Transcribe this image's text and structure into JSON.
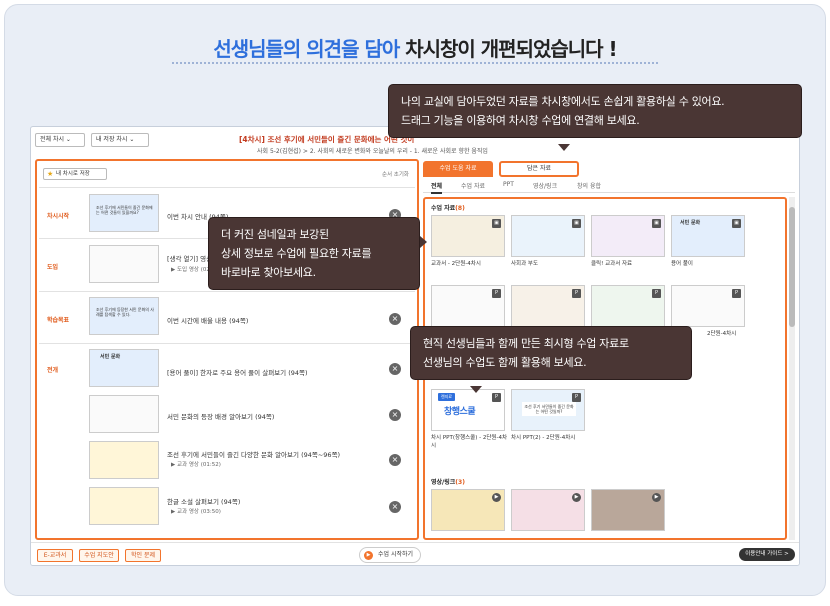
{
  "headline": {
    "part_blue": "선생님들의 의견을 담아",
    "part_dark": " 차시창이 개편되었습니다 !"
  },
  "toolbar": {
    "select_lesson": "전체 차시 ⌄",
    "select_saved": "내 저장 차시 ⌄",
    "lesson_title": "[4차시] 조선 후기에 서민들이 즐긴 문화에는 어떤 것이",
    "lesson_sub": "사회 5-2(김현섭)  >  2. 사회의 새로운 변화와 오늘날의 우리 - 1. 새로운 사회로 향한 움직임"
  },
  "left": {
    "my_lesson_btn": "내 차시로 저장",
    "reset": "순서 초기화",
    "sections": [
      {
        "label": "차시시작"
      },
      {
        "label": "도입"
      },
      {
        "label": "학습목표"
      },
      {
        "label": "전개"
      }
    ],
    "rows": [
      {
        "title": "이번 차시 안내 (94쪽)",
        "sub": ""
      },
      {
        "title": "[생각 열기] 영상 보고 생각 나누기",
        "sub": "▶ 도입 영상 (02:14)"
      },
      {
        "title": "이번 시간에 배울 내용 (94쪽)",
        "sub": ""
      },
      {
        "title": "[용어 풀이] 한자로 주요 용어 풀이 살펴보기 (94쪽)",
        "sub": ""
      },
      {
        "title": "서민 문화의 등장 배경 알아보기 (94쪽)",
        "sub": ""
      },
      {
        "title": "조선 후기에 서민들이 즐긴 다양한 문화 알아보기 (94쪽~96쪽)",
        "sub": "▶ 교과 영상 (01:52)"
      },
      {
        "title": "한글 소설 살펴보기 (94쪽)",
        "sub": "▶ 교과 영상 (03:50)"
      }
    ],
    "thumb_labels": {
      "t1": "조선 후기에 서민들이 즐긴 문화에는 어떤 것들이 있을까요?",
      "t3": "조선 후기에 등장한 서민 문화의 사례를 탐색할 수 있다.",
      "t4": "서민 문화"
    }
  },
  "bottom": {
    "btn1": "E-교과서",
    "btn2": "수업 지도안",
    "btn3": "학인 문제",
    "start": "수업 시작하기",
    "guide": "이용안내 가이드 >"
  },
  "right": {
    "tab_active": "수업 도움 자료",
    "tab_other": "담은 자료",
    "subtabs": [
      "전체",
      "수업 자료",
      "PPT",
      "영상/링크",
      "창의 융합"
    ],
    "section1": {
      "name": "수업 자료",
      "count": "(8)"
    },
    "cards_row1": [
      "교과서 - 2단원-4차시",
      "사회과 부도",
      "클릭! 교과서 자료",
      "용어 풀이"
    ],
    "cards_row2_last": "2단원-4차시",
    "section2_cards": [
      "차시 PPT(창행스쿨) - 2단원-4차시",
      "차시 PPT(2) - 2단원-4차시"
    ],
    "ppt_card_label": "창행스쿨",
    "ppt_badge": "렌지료",
    "section3": {
      "name": "영상/링크",
      "count": "(3)"
    },
    "vocab_card": "서민 문화",
    "cartoon_text": "조선 후기 서민들이 즐긴 문화는 어떤 것일까?"
  },
  "tooltips": {
    "top": [
      "나의 교실에 담아두었던 자료를 차시창에서도 손쉽게 활용하실 수 있어요.",
      "드래그 기능을 이용하여 차시창 수업에 연결해 보세요."
    ],
    "left": [
      "더 커진 섬네일과 보강된",
      "상세 정보로 수업에 필요한 자료를",
      "바로바로 찾아보세요."
    ],
    "bottom": [
      "현직 선생님들과 함께 만든 최시형 수업 자료로",
      "선생님의 수업도 함께 활용해 보세요."
    ]
  },
  "colors": {
    "accent": "#f2742d",
    "blue": "#2e6fdc",
    "tooltip_bg": "#4a3634"
  }
}
